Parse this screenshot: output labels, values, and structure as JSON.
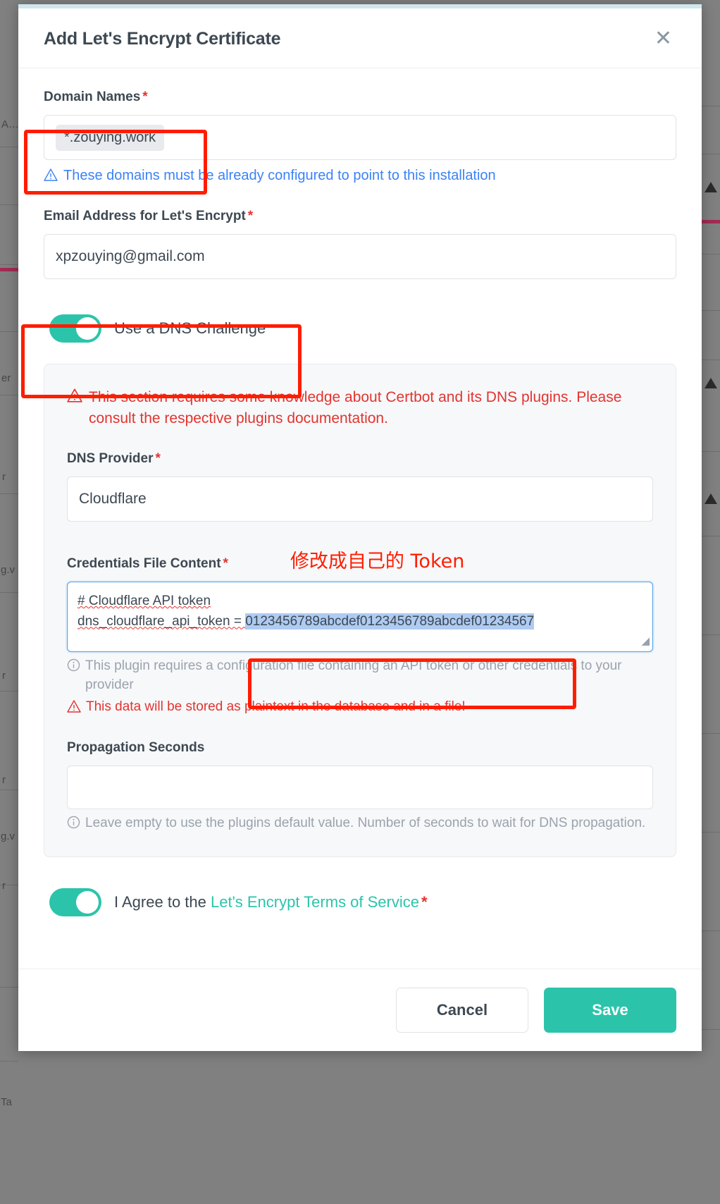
{
  "window": {
    "accent_top_color": "#cfe7ed",
    "backdrop_color": "#808080"
  },
  "modal": {
    "title": "Add Let's Encrypt Certificate",
    "close_icon": "close-icon",
    "close_glyph": "✕"
  },
  "form": {
    "domain_names": {
      "label": "Domain Names",
      "required_marker": "*",
      "tags": [
        "*.zouying.work"
      ],
      "hint": "These domains must be already configured to point to this installation",
      "hint_icon": "warning-triangle-icon",
      "hint_color": "#3b82f6"
    },
    "email": {
      "label": "Email Address for Let's Encrypt",
      "required_marker": "*",
      "value": "xpzouying@gmail.com",
      "placeholder": ""
    },
    "dns_challenge_toggle": {
      "label": "Use a DNS Challenge",
      "state": "on",
      "color": "#2bc4ab"
    },
    "dns_panel": {
      "warning": "This section requires some knowledge about Certbot and its DNS plugins. Please consult the respective plugins documentation.",
      "warning_icon": "warning-triangle-icon",
      "warning_color": "#e3342f",
      "provider": {
        "label": "DNS Provider",
        "required_marker": "*",
        "value": "Cloudflare"
      },
      "credentials": {
        "label": "Credentials File Content",
        "required_marker": "*",
        "annotation_cn": "修改成自己的 Token",
        "annotation_color": "#ff1d00",
        "line1": "# Cloudflare API token",
        "line2_key": "dns_cloudflare_api_token = ",
        "line2_value": "0123456789abcdef0123456789abcdef01234567",
        "hint": "This plugin requires a configuration file containing an API token or other credentials to your provider",
        "hint_icon": "info-circle-icon",
        "warning": "This data will be stored as plaintext in the database and in a file!",
        "warning_icon": "warning-triangle-icon"
      },
      "propagation": {
        "label": "Propagation Seconds",
        "value": "",
        "placeholder": "",
        "hint": "Leave empty to use the plugins default value. Number of seconds to wait for DNS propagation.",
        "hint_icon": "info-circle-icon"
      }
    },
    "terms_toggle": {
      "prefix": "I Agree to the ",
      "link_text": "Let's Encrypt Terms of Service",
      "required_marker": "*",
      "state": "on",
      "link_color": "#2bc4ab"
    }
  },
  "footer": {
    "cancel_label": "Cancel",
    "save_label": "Save",
    "save_color": "#2bc4ab"
  },
  "background": {
    "left_glyphs": [
      "A…",
      "er",
      "r",
      "g.v",
      "Ta"
    ],
    "right_glyphs": [
      "⚠",
      "⚠",
      "⚠"
    ]
  }
}
